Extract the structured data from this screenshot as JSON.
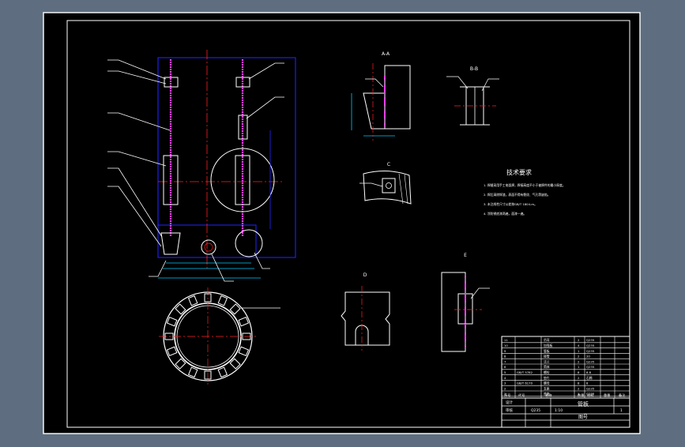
{
  "colors": {
    "background": "#5e6e80",
    "canvas": "#000000",
    "frame": "#ffffff",
    "outline": "#2222ff",
    "centerline": "#ff2020",
    "weld": "#ff40ff",
    "dimension": "#00c8ff",
    "leader": "#ffffff"
  },
  "tech_requirements": {
    "title": "技术要求",
    "lines": [
      "1. 焊缝采用手工电弧焊，焊接高度不小于被焊件的最小厚度。",
      "2. 焊后清除焊渣，表面不得有裂纹、气孔等缺陷。",
      "3. 未注线性尺寸公差按GB/T 1804-m。",
      "4. 涂防锈底漆两遍，面漆一遍。"
    ]
  },
  "views": {
    "section_a": "A-A",
    "section_b": "B-B",
    "detail_c": "C",
    "detail_d": "D",
    "view_e": "E"
  },
  "title_block": {
    "drawing_title": "管板",
    "drawing_number": "图号",
    "material": "Q235",
    "scale": "1:10",
    "quantity": "1",
    "designer": "设计",
    "checker": "审核",
    "header_no": "序号",
    "header_code": "代号",
    "header_name": "名称",
    "header_qty": "数量",
    "header_mat": "材料",
    "header_weight": "重量",
    "header_note": "备注",
    "parts": [
      {
        "no": "11",
        "code": "",
        "name": "吊耳",
        "qty": "2",
        "mat": "Q235"
      },
      {
        "no": "10",
        "code": "",
        "name": "加强板",
        "qty": "4",
        "mat": "Q235"
      },
      {
        "no": "9",
        "code": "",
        "name": "管板",
        "qty": "1",
        "mat": "Q235"
      },
      {
        "no": "8",
        "code": "",
        "name": "接管",
        "qty": "2",
        "mat": "20"
      },
      {
        "no": "7",
        "code": "",
        "name": "法兰",
        "qty": "2",
        "mat": "Q235"
      },
      {
        "no": "6",
        "code": "",
        "name": "筒体",
        "qty": "1",
        "mat": "Q235"
      },
      {
        "no": "5",
        "code": "GB/T 5782",
        "name": "螺栓",
        "qty": "8",
        "mat": "8.8"
      },
      {
        "no": "4",
        "code": "",
        "name": "垫片",
        "qty": "2",
        "mat": "石棉"
      },
      {
        "no": "3",
        "code": "GB/T 6170",
        "name": "螺母",
        "qty": "8",
        "mat": "8"
      },
      {
        "no": "2",
        "code": "",
        "name": "支座",
        "qty": "2",
        "mat": "Q235"
      },
      {
        "no": "1",
        "code": "",
        "name": "底座",
        "qty": "1",
        "mat": "Q235"
      }
    ]
  }
}
